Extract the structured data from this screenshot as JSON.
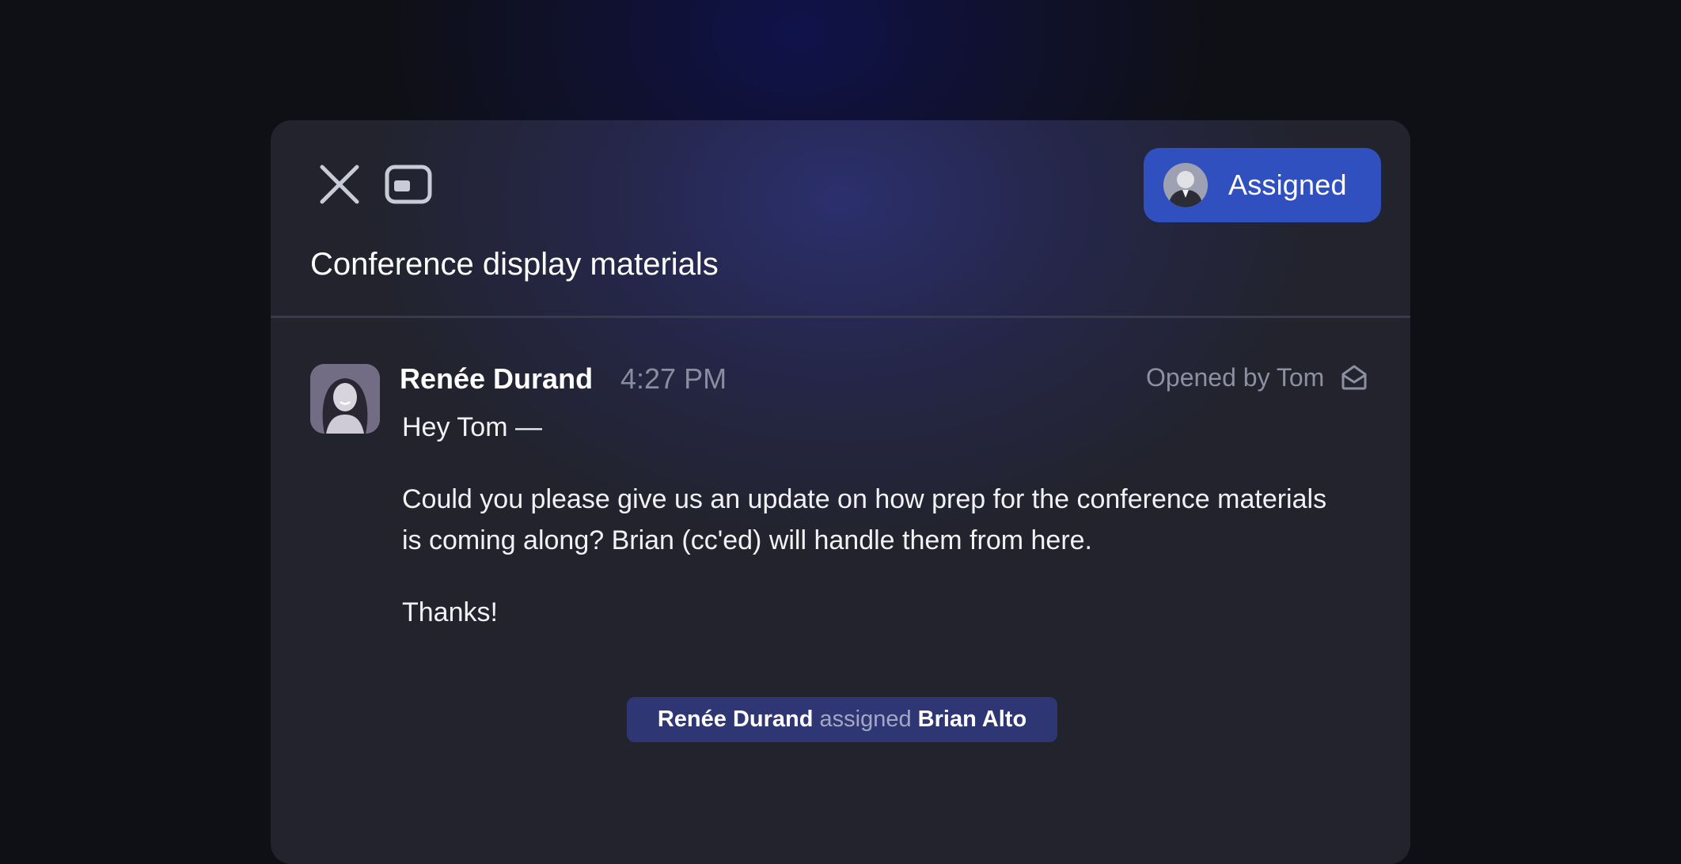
{
  "header": {
    "assigned_label": "Assigned",
    "subject": "Conference display materials"
  },
  "message": {
    "sender_name": "Renée Durand",
    "time": "4:27 PM",
    "opened_by": "Opened by Tom",
    "greeting": "Hey Tom —",
    "body_line1": "Could you please give us an update on how prep for the conference materials",
    "body_line2": "is coming along? Brian (cc'ed) will handle them from here.",
    "signoff": "Thanks!"
  },
  "activity": {
    "actor": "Renée Durand",
    "action": "assigned",
    "target": "Brian Alto"
  },
  "colors": {
    "accent": "#2f50be",
    "pill": "#2e3773",
    "panel": "#22232c"
  },
  "icons": {
    "close": "close-icon",
    "window": "window-icon",
    "envelope": "envelope-open-icon"
  }
}
